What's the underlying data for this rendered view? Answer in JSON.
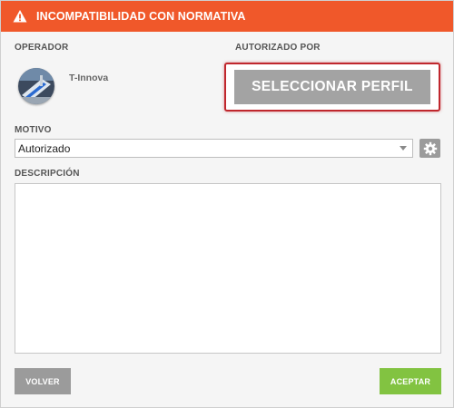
{
  "header": {
    "title": "INCOMPATIBILIDAD CON NORMATIVA",
    "icon": "warning-icon",
    "color": "#f0582a"
  },
  "operator": {
    "label": "OPERADOR",
    "name": "T-Innova"
  },
  "authorized": {
    "label": "AUTORIZADO POR",
    "button_label": "SELECCIONAR PERFIL"
  },
  "motivo": {
    "label": "MOTIVO",
    "selected": "Autorizado"
  },
  "description": {
    "label": "DESCRIPCIÓN",
    "value": ""
  },
  "footer": {
    "back_label": "VOLVER",
    "accept_label": "ACEPTAR",
    "accept_color": "#82c341"
  }
}
